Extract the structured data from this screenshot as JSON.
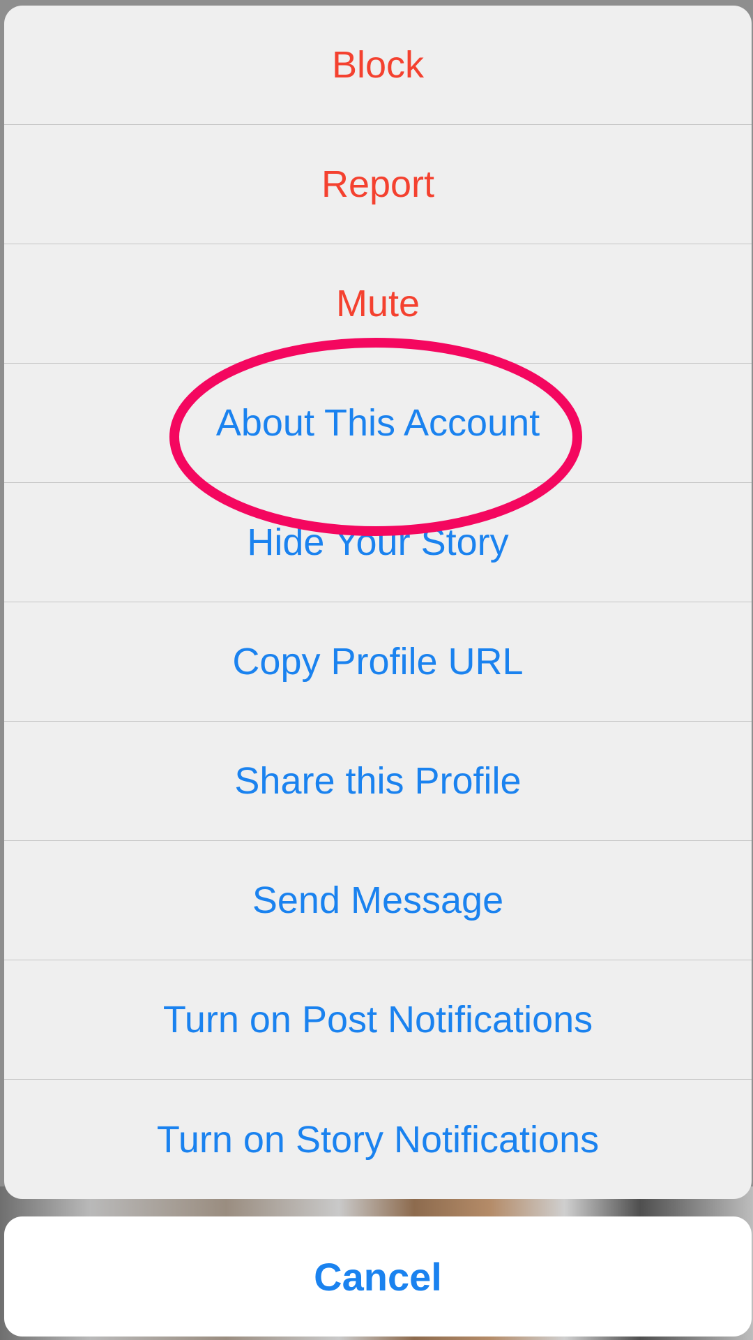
{
  "colors": {
    "destructive": "#f4412f",
    "default": "#1a82ef",
    "highlight": "#f4075f",
    "sheet_background": "#efefef",
    "cancel_background": "#ffffff"
  },
  "action_sheet": {
    "items": [
      {
        "label": "Block",
        "style": "destructive"
      },
      {
        "label": "Report",
        "style": "destructive"
      },
      {
        "label": "Mute",
        "style": "destructive"
      },
      {
        "label": "About This Account",
        "style": "default",
        "highlighted": true
      },
      {
        "label": "Hide Your Story",
        "style": "default"
      },
      {
        "label": "Copy Profile URL",
        "style": "default"
      },
      {
        "label": "Share this Profile",
        "style": "default"
      },
      {
        "label": "Send Message",
        "style": "default"
      },
      {
        "label": "Turn on Post Notifications",
        "style": "default"
      },
      {
        "label": "Turn on Story Notifications",
        "style": "default"
      }
    ],
    "cancel_label": "Cancel"
  }
}
